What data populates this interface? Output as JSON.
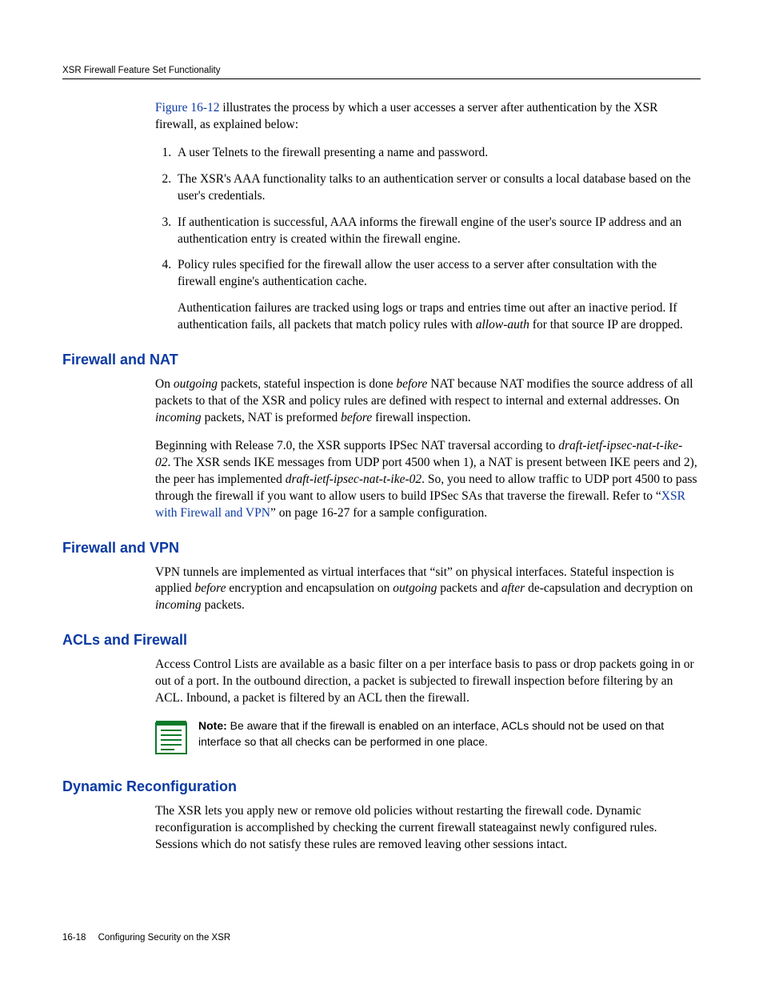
{
  "runningHead": "XSR Firewall Feature Set Functionality",
  "intro": {
    "linkText": "Figure 16-12",
    "rest": " illustrates the process by which a user accesses a server after authentication by the XSR firewall, as explained below:"
  },
  "steps": {
    "s1": "A user Telnets to the firewall presenting a name and password.",
    "s2": "The XSR's AAA functionality talks to an authentication server or consults a local database based on the user's credentials.",
    "s3": "If authentication is successful, AAA informs the firewall engine of the user's source IP address and an authentication entry is created within the firewall engine.",
    "s4": "Policy rules specified for the firewall allow the user access to a server after consultation with the firewall engine's authentication cache.",
    "s4b_pre": "Authentication failures are tracked using logs or traps and entries time out after an inactive period. If authentication fails, all packets that match policy rules with ",
    "s4b_ital": "allow-auth",
    "s4b_post": " for that source IP are dropped."
  },
  "fwnat": {
    "heading": "Firewall and NAT",
    "p1_a": "On ",
    "p1_b": "outgoing",
    "p1_c": " packets, stateful inspection is done ",
    "p1_d": "before",
    "p1_e": " NAT because NAT modifies the source address of all packets to that of the XSR and policy rules are defined with respect to internal and external addresses. On ",
    "p1_f": "incoming",
    "p1_g": " packets, NAT is preformed ",
    "p1_h": "before",
    "p1_i": " firewall inspection.",
    "p2_a": "Beginning with Release 7.0, the XSR supports IPSec NAT traversal according to ",
    "p2_b": "draft-ietf-ipsec-nat-t-ike-02",
    "p2_c": ". The XSR sends IKE messages from UDP port 4500 when 1), a NAT is present between IKE peers and 2), the peer has implemented ",
    "p2_d": "draft-ietf-ipsec-nat-t-ike-02",
    "p2_e": ". So, you need to allow traffic to UDP port 4500 to pass through the firewall if you want to allow users to build IPSec SAs that traverse the firewall. Refer to “",
    "p2_link": "XSR with Firewall and VPN",
    "p2_f": "” on page 16-27 for a sample configuration."
  },
  "fwvpn": {
    "heading": "Firewall and VPN",
    "p_a": "VPN tunnels are implemented as virtual interfaces that “sit” on physical interfaces. Stateful inspection is applied ",
    "p_b": "before",
    "p_c": " encryption and encapsulation on ",
    "p_d": "outgoing",
    "p_e": " packets and ",
    "p_f": "after",
    "p_g": " de-capsulation and decryption on ",
    "p_h": "incoming",
    "p_i": " packets."
  },
  "acls": {
    "heading": "ACLs and Firewall",
    "p": "Access Control Lists are available as a basic filter on a per interface basis to pass or drop packets going in or out of a port. In the outbound direction, a packet is subjected to firewall inspection before filtering by an ACL. Inbound, a packet is filtered by an ACL then the firewall.",
    "note_label": "Note:",
    "note_text": " Be aware that if the firewall is enabled on an interface, ACLs should not be used on that interface so that all checks can be performed in one place."
  },
  "dynrec": {
    "heading": "Dynamic Reconfiguration",
    "p": "The XSR lets you apply new or remove old policies without restarting the firewall code. Dynamic reconfiguration is accomplished by checking the current firewall stateagainst newly configured rules. Sessions which do not satisfy these rules are removed leaving other sessions intact."
  },
  "footer": {
    "page": "16-18",
    "title": "Configuring Security on the XSR"
  }
}
